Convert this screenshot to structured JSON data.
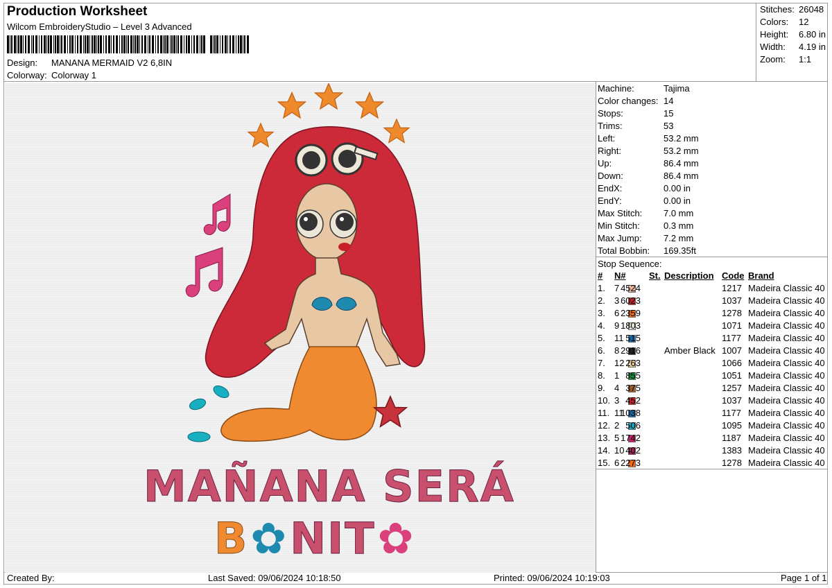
{
  "header": {
    "title": "Production Worksheet",
    "subtitle": "Wilcom EmbroideryStudio – Level 3 Advanced",
    "design_label": "Design:",
    "design_value": "MANANA MERMAID V2 6,8IN",
    "colorway_label": "Colorway:",
    "colorway_value": "Colorway 1"
  },
  "summary": [
    {
      "label": "Stitches:",
      "value": "26048"
    },
    {
      "label": "Colors:",
      "value": "12"
    },
    {
      "label": "Height:",
      "value": "6.80 in"
    },
    {
      "label": "Width:",
      "value": "4.19 in"
    },
    {
      "label": "Zoom:",
      "value": "1:1"
    }
  ],
  "machine_info": [
    {
      "label": "Machine:",
      "value": "Tajima"
    },
    {
      "label": "Color changes:",
      "value": "14"
    },
    {
      "label": "Stops:",
      "value": "15"
    },
    {
      "label": "Trims:",
      "value": "53"
    },
    {
      "label": "Left:",
      "value": "53.2 mm"
    },
    {
      "label": "Right:",
      "value": "53.2 mm"
    },
    {
      "label": "Up:",
      "value": "86.4 mm"
    },
    {
      "label": "Down:",
      "value": "86.4 mm"
    },
    {
      "label": "EndX:",
      "value": "0.00 in"
    },
    {
      "label": "EndY:",
      "value": "0.00 in"
    },
    {
      "label": "Max Stitch:",
      "value": "7.0 mm"
    },
    {
      "label": "Min Stitch:",
      "value": "0.3 mm"
    },
    {
      "label": "Max Jump:",
      "value": "7.2 mm"
    },
    {
      "label": "Total Bobbin:",
      "value": "169.35ft"
    }
  ],
  "stop_sequence": {
    "title": "Stop Sequence:",
    "headers": {
      "stop": "#",
      "needle": "N#",
      "stitches": "St.",
      "description": "Description",
      "code": "Code",
      "brand": "Brand"
    },
    "rows": [
      {
        "stop": "1.",
        "needle": "7",
        "color": "#f2b8a2",
        "stitches": "4524",
        "description": "",
        "code": "1217",
        "brand": "Madeira Classic 40"
      },
      {
        "stop": "2.",
        "needle": "3",
        "color": "#c8202a",
        "stitches": "6023",
        "description": "",
        "code": "1037",
        "brand": "Madeira Classic 40"
      },
      {
        "stop": "3.",
        "needle": "6",
        "color": "#f06a1c",
        "stitches": "2359",
        "description": "",
        "code": "1278",
        "brand": "Madeira Classic 40"
      },
      {
        "stop": "4.",
        "needle": "9",
        "color": "#ece6d8",
        "stitches": "1803",
        "description": "",
        "code": "1071",
        "brand": "Madeira Classic 40"
      },
      {
        "stop": "5.",
        "needle": "11",
        "color": "#1568a8",
        "stitches": "515",
        "description": "",
        "code": "1177",
        "brand": "Madeira Classic 40"
      },
      {
        "stop": "6.",
        "needle": "8",
        "color": "#222222",
        "stitches": "2916",
        "description": "Amber Black",
        "code": "1007",
        "brand": "Madeira Classic 40"
      },
      {
        "stop": "7.",
        "needle": "12",
        "color": "#f4d3a0",
        "stitches": "263",
        "description": "",
        "code": "1066",
        "brand": "Madeira Classic 40"
      },
      {
        "stop": "8.",
        "needle": "1",
        "color": "#148a3c",
        "stitches": "855",
        "description": "",
        "code": "1051",
        "brand": "Madeira Classic 40"
      },
      {
        "stop": "9.",
        "needle": "4",
        "color": "#9a5a2a",
        "stitches": "375",
        "description": "",
        "code": "1257",
        "brand": "Madeira Classic 40"
      },
      {
        "stop": "10.",
        "needle": "3",
        "color": "#c8202a",
        "stitches": "452",
        "description": "",
        "code": "1037",
        "brand": "Madeira Classic 40"
      },
      {
        "stop": "11.",
        "needle": "11",
        "color": "#1568a8",
        "stitches": "1038",
        "description": "",
        "code": "1177",
        "brand": "Madeira Classic 40"
      },
      {
        "stop": "12.",
        "needle": "2",
        "color": "#13a8c0",
        "stitches": "506",
        "description": "",
        "code": "1095",
        "brand": "Madeira Classic 40"
      },
      {
        "stop": "13.",
        "needle": "5",
        "color": "#c4206a",
        "stitches": "1742",
        "description": "",
        "code": "1187",
        "brand": "Madeira Classic 40"
      },
      {
        "stop": "14.",
        "needle": "10",
        "color": "#a02055",
        "stitches": "402",
        "description": "",
        "code": "1383",
        "brand": "Madeira Classic 40"
      },
      {
        "stop": "15.",
        "needle": "6",
        "color": "#f06a1c",
        "stitches": "2273",
        "description": "",
        "code": "1278",
        "brand": "Madeira Classic 40"
      }
    ]
  },
  "artwork": {
    "line1": "MAÑANA SERÁ",
    "line2_b": "B",
    "line2_nit": "NIT"
  },
  "footer": {
    "created_by": "Created By:",
    "last_saved": "Last Saved: 09/06/2024 10:18:50",
    "printed": "Printed: 09/06/2024 10:19:03",
    "page": "Page 1 of 1"
  }
}
